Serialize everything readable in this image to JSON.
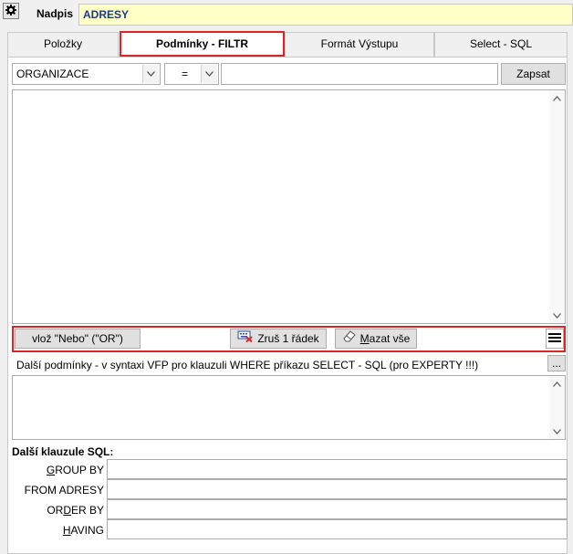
{
  "header": {
    "nadpis_label": "Nadpis",
    "nadpis_value": "ADRESY"
  },
  "tabs": [
    {
      "label": "Položky",
      "active": false
    },
    {
      "label": "Podmínky - FILTR",
      "active": true
    },
    {
      "label": "Formát Výstupu",
      "active": false
    },
    {
      "label": "Select - SQL",
      "active": false
    }
  ],
  "filter": {
    "field_value": "ORGANIZACE",
    "operator_value": "=",
    "condition_value": "",
    "write_button": "Zapsat"
  },
  "buttons": {
    "or_button": "vlož \"Nebo\" (\"OR\")",
    "delete_row_button": "Zruš 1 řádek",
    "clear_all_button": "Mazat vše",
    "ellipsis_button": "..."
  },
  "extra": {
    "conditions_label": "Další podmínky - v syntaxi VFP pro klauzuli WHERE příkazu SELECT - SQL (pro EXPERTY !!!)",
    "clauses_heading": "Další klauzule SQL:",
    "group_by_label": "GROUP BY",
    "from_label": "FROM ADRESY",
    "order_by_label": "ORDER BY",
    "having_label": "HAVING"
  },
  "colors": {
    "accent_red": "#d9262b",
    "title_field_bg": "#ffffc6",
    "title_text": "#1a3a8c"
  }
}
